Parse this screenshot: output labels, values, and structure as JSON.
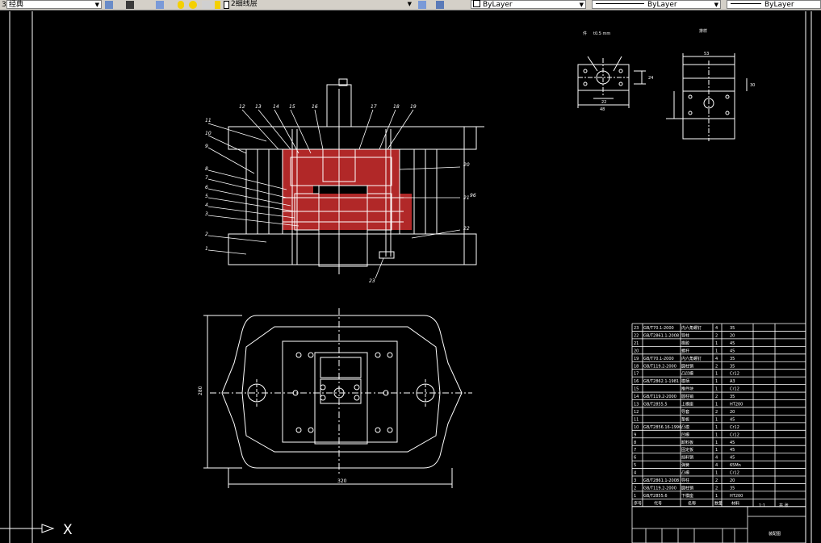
{
  "toolbar": {
    "workspace_value": "经典",
    "workspace_prefix": "3",
    "layer_value": "2细线层",
    "color_value": "ByLayer",
    "linetype_value": "ByLayer",
    "lineweight_value": "ByLayer"
  },
  "ucs": {
    "x_label": "X"
  },
  "drawing": {
    "callouts_top": [
      "12",
      "13",
      "14",
      "15",
      "16",
      "17",
      "18",
      "19"
    ],
    "callouts_left": [
      "11",
      "10",
      "9",
      "8",
      "7",
      "6",
      "5",
      "4",
      "3",
      "2",
      "1"
    ],
    "callouts_right": [
      "20",
      "21",
      "22"
    ],
    "callout_bottom": "23",
    "dim_right": "96",
    "dim_plan_height": "280",
    "dim_plan_width": "320",
    "part_label": "件",
    "part_label_dim": "t0.5 mm",
    "blank_label": "排样",
    "dim_part_w": "48",
    "dim_part_d": "22",
    "dim_part_h": "24",
    "dim_blank_w": "53",
    "dim_blank_h": "30"
  },
  "bom": {
    "rows": [
      {
        "no": "23",
        "std": "GB/T70.1-2000",
        "name": "内六角螺钉",
        "qty": "4",
        "mat": "35"
      },
      {
        "no": "22",
        "std": "GB/T2861.1-2008",
        "name": "导柱",
        "qty": "2",
        "mat": "20"
      },
      {
        "no": "21",
        "std": "",
        "name": "橡胶",
        "qty": "1",
        "mat": "45"
      },
      {
        "no": "20",
        "std": "",
        "name": "螺杆",
        "qty": "1",
        "mat": "45"
      },
      {
        "no": "19",
        "std": "GB/T70.1-2000",
        "name": "内六角螺钉",
        "qty": "4",
        "mat": "35"
      },
      {
        "no": "18",
        "std": "GB/T119.2-2000",
        "name": "圆柱销",
        "qty": "2",
        "mat": "35"
      },
      {
        "no": "17",
        "std": "",
        "name": "凸凹模",
        "qty": "1",
        "mat": "Cr12"
      },
      {
        "no": "16",
        "std": "GB/T2862.1-1981",
        "name": "模柄",
        "qty": "1",
        "mat": "A3"
      },
      {
        "no": "15",
        "std": "",
        "name": "推件块",
        "qty": "1",
        "mat": "Cr12"
      },
      {
        "no": "14",
        "std": "GB/T119.2-2000",
        "name": "圆柱销",
        "qty": "2",
        "mat": "35"
      },
      {
        "no": "13",
        "std": "GB/T2855.5",
        "name": "上模座",
        "qty": "1",
        "mat": "HT200"
      },
      {
        "no": "12",
        "std": "",
        "name": "导套",
        "qty": "2",
        "mat": "20"
      },
      {
        "no": "11",
        "std": "",
        "name": "垫板",
        "qty": "1",
        "mat": "45"
      },
      {
        "no": "10",
        "std": "GB/T2856.16-1990",
        "name": "凸模",
        "qty": "1",
        "mat": "Cr12"
      },
      {
        "no": "9",
        "std": "",
        "name": "凹模",
        "qty": "1",
        "mat": "Cr12"
      },
      {
        "no": "8",
        "std": "",
        "name": "卸料板",
        "qty": "1",
        "mat": "45"
      },
      {
        "no": "7",
        "std": "",
        "name": "固定板",
        "qty": "1",
        "mat": "45"
      },
      {
        "no": "6",
        "std": "",
        "name": "挡料销",
        "qty": "4",
        "mat": "45"
      },
      {
        "no": "5",
        "std": "",
        "name": "弹簧",
        "qty": "4",
        "mat": "65Mn"
      },
      {
        "no": "4",
        "std": "",
        "name": "凸模",
        "qty": "1",
        "mat": "Cr12"
      },
      {
        "no": "3",
        "std": "GB/T2861.1-2008",
        "name": "导柱",
        "qty": "2",
        "mat": "20"
      },
      {
        "no": "2",
        "std": "GB/T119.2-2000",
        "name": "圆柱销",
        "qty": "2",
        "mat": "35"
      },
      {
        "no": "1",
        "std": "GB/T2855.6",
        "name": "下模座",
        "qty": "1",
        "mat": "HT200"
      }
    ],
    "header": {
      "no": "序号",
      "std": "代号",
      "name": "名称",
      "qty": "数量",
      "mat": "材料"
    },
    "title_block": {
      "drawing_name": "装配图",
      "scale": "1:1",
      "sheet": "共 张"
    }
  },
  "colors": {
    "line": "#ffffff",
    "hatch_red": "#ff2020",
    "center_green": "#e0e0e0",
    "bg": "#000000"
  }
}
